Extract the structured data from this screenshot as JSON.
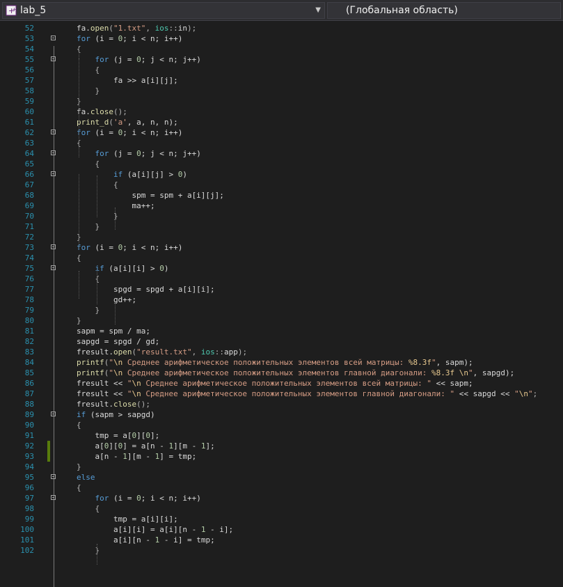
{
  "title_bar": {
    "project": "lab_5",
    "scope": "(Глобальная область)"
  },
  "editor": {
    "lines": [
      {
        "n": "52",
        "fold": false,
        "changed": false,
        "tokens": [
          {
            "t": "fa.",
            "c": "var"
          },
          {
            "t": "open",
            "c": "fn"
          },
          {
            "t": "(",
            "c": "punc"
          },
          {
            "t": "\"1.txt\"",
            "c": "str"
          },
          {
            "t": ", ",
            "c": "punc"
          },
          {
            "t": "ios",
            "c": "ns"
          },
          {
            "t": "::",
            "c": "punc"
          },
          {
            "t": "in",
            "c": "var"
          },
          {
            "t": ");",
            "c": "punc"
          }
        ]
      },
      {
        "n": "53",
        "fold": true,
        "changed": false,
        "tokens": [
          {
            "t": "for",
            "c": "kw"
          },
          {
            "t": " (i = ",
            "c": "var"
          },
          {
            "t": "0",
            "c": "num"
          },
          {
            "t": "; i < n; i++)",
            "c": "var"
          }
        ]
      },
      {
        "n": "54",
        "fold": false,
        "changed": false,
        "tokens": [
          {
            "t": "{",
            "c": "punc"
          }
        ]
      },
      {
        "n": "55",
        "fold": true,
        "changed": false,
        "tokens": [
          {
            "t": "    "
          },
          {
            "t": "for",
            "c": "kw"
          },
          {
            "t": " (j = ",
            "c": "var"
          },
          {
            "t": "0",
            "c": "num"
          },
          {
            "t": "; j < n; j++)",
            "c": "var"
          }
        ]
      },
      {
        "n": "56",
        "fold": false,
        "changed": false,
        "tokens": [
          {
            "t": "    {",
            "c": "punc"
          }
        ]
      },
      {
        "n": "57",
        "fold": false,
        "changed": false,
        "tokens": [
          {
            "t": "        fa >> a[i][j];",
            "c": "var"
          }
        ]
      },
      {
        "n": "58",
        "fold": false,
        "changed": false,
        "tokens": [
          {
            "t": "    }",
            "c": "punc"
          }
        ]
      },
      {
        "n": "59",
        "fold": false,
        "changed": false,
        "tokens": [
          {
            "t": "}",
            "c": "punc"
          }
        ]
      },
      {
        "n": "60",
        "fold": false,
        "changed": false,
        "tokens": [
          {
            "t": "fa.",
            "c": "var"
          },
          {
            "t": "close",
            "c": "fn"
          },
          {
            "t": "();",
            "c": "punc"
          }
        ]
      },
      {
        "n": "61",
        "fold": false,
        "changed": false,
        "tokens": [
          {
            "t": "print_d",
            "c": "fn"
          },
          {
            "t": "(",
            "c": "punc"
          },
          {
            "t": "'a'",
            "c": "str"
          },
          {
            "t": ", a, n, n);",
            "c": "var"
          }
        ]
      },
      {
        "n": "62",
        "fold": true,
        "changed": false,
        "tokens": [
          {
            "t": "for",
            "c": "kw"
          },
          {
            "t": " (i = ",
            "c": "var"
          },
          {
            "t": "0",
            "c": "num"
          },
          {
            "t": "; i < n; i++)",
            "c": "var"
          }
        ]
      },
      {
        "n": "63",
        "fold": false,
        "changed": false,
        "tokens": [
          {
            "t": "{",
            "c": "punc"
          }
        ]
      },
      {
        "n": "64",
        "fold": true,
        "changed": false,
        "tokens": [
          {
            "t": "    "
          },
          {
            "t": "for",
            "c": "kw"
          },
          {
            "t": " (j = ",
            "c": "var"
          },
          {
            "t": "0",
            "c": "num"
          },
          {
            "t": "; j < n; j++)",
            "c": "var"
          }
        ]
      },
      {
        "n": "65",
        "fold": false,
        "changed": false,
        "tokens": [
          {
            "t": "    {",
            "c": "punc"
          }
        ]
      },
      {
        "n": "66",
        "fold": true,
        "changed": false,
        "tokens": [
          {
            "t": "        "
          },
          {
            "t": "if",
            "c": "kw"
          },
          {
            "t": " (a[i][j] > ",
            "c": "var"
          },
          {
            "t": "0",
            "c": "num"
          },
          {
            "t": ")",
            "c": "var"
          }
        ]
      },
      {
        "n": "67",
        "fold": false,
        "changed": false,
        "tokens": [
          {
            "t": "        {",
            "c": "punc"
          }
        ]
      },
      {
        "n": "68",
        "fold": false,
        "changed": false,
        "tokens": [
          {
            "t": "            spm = spm + a[i][j];",
            "c": "var"
          }
        ]
      },
      {
        "n": "69",
        "fold": false,
        "changed": false,
        "tokens": [
          {
            "t": "            ma++;",
            "c": "var"
          }
        ]
      },
      {
        "n": "70",
        "fold": false,
        "changed": false,
        "tokens": [
          {
            "t": "        }",
            "c": "punc"
          }
        ]
      },
      {
        "n": "71",
        "fold": false,
        "changed": false,
        "tokens": [
          {
            "t": "    }",
            "c": "punc"
          }
        ]
      },
      {
        "n": "72",
        "fold": false,
        "changed": false,
        "tokens": [
          {
            "t": "}",
            "c": "punc"
          }
        ]
      },
      {
        "n": "73",
        "fold": true,
        "changed": false,
        "tokens": [
          {
            "t": "for",
            "c": "kw"
          },
          {
            "t": " (i = ",
            "c": "var"
          },
          {
            "t": "0",
            "c": "num"
          },
          {
            "t": "; i < n; i++)",
            "c": "var"
          }
        ]
      },
      {
        "n": "74",
        "fold": false,
        "changed": false,
        "tokens": [
          {
            "t": "{",
            "c": "punc"
          }
        ]
      },
      {
        "n": "75",
        "fold": true,
        "changed": false,
        "tokens": [
          {
            "t": "    "
          },
          {
            "t": "if",
            "c": "kw"
          },
          {
            "t": " (a[i][i] > ",
            "c": "var"
          },
          {
            "t": "0",
            "c": "num"
          },
          {
            "t": ")",
            "c": "var"
          }
        ]
      },
      {
        "n": "76",
        "fold": false,
        "changed": false,
        "tokens": [
          {
            "t": "    {",
            "c": "punc"
          }
        ]
      },
      {
        "n": "77",
        "fold": false,
        "changed": false,
        "tokens": [
          {
            "t": "        spgd = spgd + a[i][i];",
            "c": "var"
          }
        ]
      },
      {
        "n": "78",
        "fold": false,
        "changed": false,
        "tokens": [
          {
            "t": "        gd++;",
            "c": "var"
          }
        ]
      },
      {
        "n": "79",
        "fold": false,
        "changed": false,
        "tokens": [
          {
            "t": "    }",
            "c": "punc"
          }
        ]
      },
      {
        "n": "80",
        "fold": false,
        "changed": false,
        "tokens": [
          {
            "t": "}",
            "c": "punc"
          }
        ]
      },
      {
        "n": "81",
        "fold": false,
        "changed": false,
        "tokens": [
          {
            "t": "sapm = spm / ma;",
            "c": "var"
          }
        ]
      },
      {
        "n": "82",
        "fold": false,
        "changed": false,
        "tokens": [
          {
            "t": "sapgd = spgd / gd;",
            "c": "var"
          }
        ]
      },
      {
        "n": "83",
        "fold": false,
        "changed": false,
        "tokens": [
          {
            "t": "fresult.",
            "c": "var"
          },
          {
            "t": "open",
            "c": "fn"
          },
          {
            "t": "(",
            "c": "punc"
          },
          {
            "t": "\"result.txt\"",
            "c": "str"
          },
          {
            "t": ", ",
            "c": "punc"
          },
          {
            "t": "ios",
            "c": "ns"
          },
          {
            "t": "::",
            "c": "punc"
          },
          {
            "t": "app",
            "c": "var"
          },
          {
            "t": ");",
            "c": "punc"
          }
        ]
      },
      {
        "n": "84",
        "fold": false,
        "changed": false,
        "tokens": [
          {
            "t": "printf",
            "c": "fn"
          },
          {
            "t": "(",
            "c": "punc"
          },
          {
            "t": "\"",
            "c": "str"
          },
          {
            "t": "\\n",
            "c": "esc"
          },
          {
            "t": " Среднее арифметическое положительных элементов всей матрицы: ",
            "c": "str"
          },
          {
            "t": "%8.3f",
            "c": "esc"
          },
          {
            "t": "\"",
            "c": "str"
          },
          {
            "t": ", sapm);",
            "c": "var"
          }
        ]
      },
      {
        "n": "85",
        "fold": false,
        "changed": false,
        "tokens": [
          {
            "t": "printf",
            "c": "fn"
          },
          {
            "t": "(",
            "c": "punc"
          },
          {
            "t": "\"",
            "c": "str"
          },
          {
            "t": "\\n",
            "c": "esc"
          },
          {
            "t": " Среднее арифметическое положительных элементов главной диагонали: ",
            "c": "str"
          },
          {
            "t": "%8.3f",
            "c": "esc"
          },
          {
            "t": " ",
            "c": "str"
          },
          {
            "t": "\\n",
            "c": "esc"
          },
          {
            "t": "\"",
            "c": "str"
          },
          {
            "t": ", sapgd);",
            "c": "var"
          }
        ]
      },
      {
        "n": "86",
        "fold": false,
        "changed": false,
        "tokens": [
          {
            "t": "fresult << ",
            "c": "var"
          },
          {
            "t": "\"",
            "c": "str"
          },
          {
            "t": "\\n",
            "c": "esc"
          },
          {
            "t": " Среднее арифметическое положительных элементов всей матрицы: \"",
            "c": "str"
          },
          {
            "t": " << sapm;",
            "c": "var"
          }
        ]
      },
      {
        "n": "87",
        "fold": false,
        "changed": false,
        "tokens": [
          {
            "t": "fresult << ",
            "c": "var"
          },
          {
            "t": "\"",
            "c": "str"
          },
          {
            "t": "\\n",
            "c": "esc"
          },
          {
            "t": " Среднее арифметическое положительных элементов главной диагонали: \"",
            "c": "str"
          },
          {
            "t": " << sapgd << ",
            "c": "var"
          },
          {
            "t": "\"",
            "c": "str"
          },
          {
            "t": "\\n",
            "c": "esc"
          },
          {
            "t": "\"",
            "c": "str"
          },
          {
            "t": ";",
            "c": "punc"
          }
        ]
      },
      {
        "n": "88",
        "fold": false,
        "changed": false,
        "tokens": [
          {
            "t": "fresult.",
            "c": "var"
          },
          {
            "t": "close",
            "c": "fn"
          },
          {
            "t": "();",
            "c": "punc"
          }
        ]
      },
      {
        "n": "89",
        "fold": true,
        "changed": false,
        "tokens": [
          {
            "t": "if",
            "c": "kw"
          },
          {
            "t": " (sapm > sapgd)",
            "c": "var"
          }
        ]
      },
      {
        "n": "90",
        "fold": false,
        "changed": false,
        "tokens": [
          {
            "t": "{",
            "c": "punc"
          }
        ]
      },
      {
        "n": "91",
        "fold": false,
        "changed": false,
        "tokens": [
          {
            "t": "    tmp = a[",
            "c": "var"
          },
          {
            "t": "0",
            "c": "num"
          },
          {
            "t": "][",
            "c": "var"
          },
          {
            "t": "0",
            "c": "num"
          },
          {
            "t": "];",
            "c": "var"
          }
        ]
      },
      {
        "n": "92",
        "fold": false,
        "changed": true,
        "tokens": [
          {
            "t": "    a[",
            "c": "var"
          },
          {
            "t": "0",
            "c": "num"
          },
          {
            "t": "][",
            "c": "var"
          },
          {
            "t": "0",
            "c": "num"
          },
          {
            "t": "] = a[n - ",
            "c": "var"
          },
          {
            "t": "1",
            "c": "num"
          },
          {
            "t": "][m - ",
            "c": "var"
          },
          {
            "t": "1",
            "c": "num"
          },
          {
            "t": "];",
            "c": "var"
          }
        ]
      },
      {
        "n": "93",
        "fold": false,
        "changed": true,
        "tokens": [
          {
            "t": "    a[n - ",
            "c": "var"
          },
          {
            "t": "1",
            "c": "num"
          },
          {
            "t": "][m - ",
            "c": "var"
          },
          {
            "t": "1",
            "c": "num"
          },
          {
            "t": "] = tmp;",
            "c": "var"
          }
        ]
      },
      {
        "n": "94",
        "fold": false,
        "changed": false,
        "tokens": [
          {
            "t": "}",
            "c": "punc"
          }
        ]
      },
      {
        "n": "95",
        "fold": true,
        "changed": false,
        "tokens": [
          {
            "t": "else",
            "c": "kw"
          }
        ]
      },
      {
        "n": "96",
        "fold": false,
        "changed": false,
        "tokens": [
          {
            "t": "{",
            "c": "punc"
          }
        ]
      },
      {
        "n": "97",
        "fold": true,
        "changed": false,
        "tokens": [
          {
            "t": "    "
          },
          {
            "t": "for",
            "c": "kw"
          },
          {
            "t": " (i = ",
            "c": "var"
          },
          {
            "t": "0",
            "c": "num"
          },
          {
            "t": "; i < n; i++)",
            "c": "var"
          }
        ]
      },
      {
        "n": "98",
        "fold": false,
        "changed": false,
        "tokens": [
          {
            "t": "    {",
            "c": "punc"
          }
        ]
      },
      {
        "n": "99",
        "fold": false,
        "changed": false,
        "tokens": [
          {
            "t": "        tmp = a[i][i];",
            "c": "var"
          }
        ]
      },
      {
        "n": "100",
        "fold": false,
        "changed": false,
        "tokens": [
          {
            "t": "        a[i][i] = a[i][n - ",
            "c": "var"
          },
          {
            "t": "1",
            "c": "num"
          },
          {
            "t": " - i];",
            "c": "var"
          }
        ]
      },
      {
        "n": "101",
        "fold": false,
        "changed": false,
        "tokens": [
          {
            "t": "        a[i][n - ",
            "c": "var"
          },
          {
            "t": "1",
            "c": "num"
          },
          {
            "t": " - i] = tmp;",
            "c": "var"
          }
        ]
      },
      {
        "n": "102",
        "fold": false,
        "changed": false,
        "tokens": [
          {
            "t": "    }",
            "c": "punc"
          }
        ]
      }
    ]
  }
}
